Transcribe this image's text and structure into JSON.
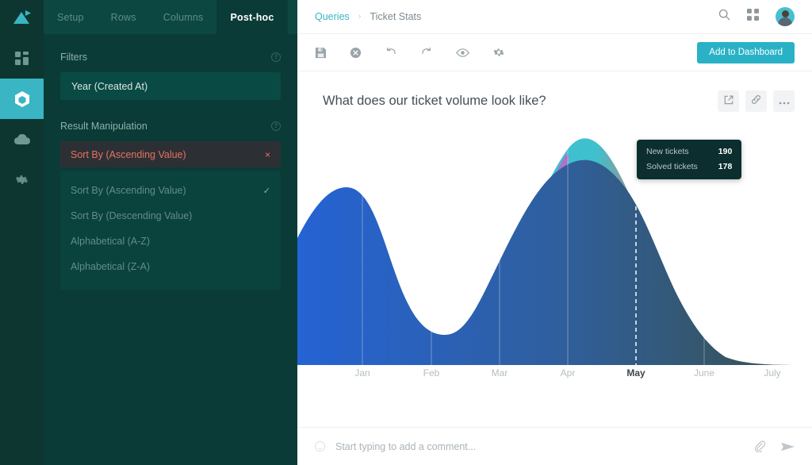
{
  "rail": {
    "logo_icon": "play-triangle-logo",
    "items": [
      {
        "icon": "dashboard-grid-icon",
        "name": "dashboard",
        "active": false
      },
      {
        "icon": "hexagon-query-icon",
        "name": "queries",
        "active": true
      },
      {
        "icon": "cloud-icon",
        "name": "cloud",
        "active": false
      },
      {
        "icon": "gear-icon",
        "name": "settings",
        "active": false
      }
    ]
  },
  "panel": {
    "tabs": [
      {
        "label": "Setup",
        "active": false
      },
      {
        "label": "Rows",
        "active": false
      },
      {
        "label": "Columns",
        "active": false
      },
      {
        "label": "Post-hoc",
        "active": true
      }
    ],
    "filters": {
      "heading": "Filters",
      "help": "?",
      "value": "Year (Created At)"
    },
    "result_manipulation": {
      "heading": "Result Manipulation",
      "help": "?",
      "selected": "Sort By (Ascending Value)",
      "remove_label": "×",
      "options": [
        {
          "label": "Sort By (Ascending Value)",
          "checked": true
        },
        {
          "label": "Sort By (Descending Value)",
          "checked": false
        },
        {
          "label": "Alphabetical (A-Z)",
          "checked": false
        },
        {
          "label": "Alphabetical (Z-A)",
          "checked": false
        }
      ],
      "check_glyph": "✓"
    }
  },
  "topbar": {
    "breadcrumb_root": "Queries",
    "breadcrumb_sep": "›",
    "breadcrumb_current": "Ticket Stats",
    "search_icon": "search-icon",
    "apps_icon": "apps-grid-icon",
    "avatar_icon": "user-avatar"
  },
  "toolbar": {
    "icons": [
      "save-icon",
      "cancel-icon",
      "undo-icon",
      "redo-icon",
      "preview-eye-icon",
      "settings-gear-icon"
    ],
    "primary_label": "Add to Dashboard"
  },
  "question": {
    "title": "What does our ticket volume look like?",
    "actions": [
      "open-external-icon",
      "link-icon",
      "more-options-icon"
    ]
  },
  "comment": {
    "placeholder": "Start typing to add a comment...",
    "value": "",
    "smiley_icon": "smiley-icon",
    "attach_icon": "paperclip-icon",
    "send_icon": "send-icon"
  },
  "colors": {
    "accent": "#3ab5c4",
    "panel_bg": "#0b3b37",
    "rail_bg": "#0d3631",
    "chip_red": "#e8705f",
    "series_new": "#2f6fd6",
    "series_solved": "#3fc0cf",
    "series_solved_end": "#ea6a5a",
    "overlap_purple": "#b070c8",
    "tooltip_bg": "#0c2e2e"
  },
  "chart_data": {
    "type": "area",
    "title": "What does our ticket volume look like?",
    "xlabel": "",
    "ylabel": "",
    "grid": true,
    "legend_position": "none",
    "categories": [
      "Jan",
      "Feb",
      "Mar",
      "Apr",
      "May",
      "June",
      "July"
    ],
    "active_category": "May",
    "tooltip": {
      "category": "May",
      "rows": [
        {
          "label": "New tickets",
          "value": 190
        },
        {
          "label": "Solved tickets",
          "value": 178
        }
      ]
    },
    "series": [
      {
        "name": "New tickets",
        "color": "#2f6fd6",
        "values": [
          110,
          150,
          120,
          62,
          40,
          95,
          190,
          175,
          120,
          60
        ]
      },
      {
        "name": "Solved tickets",
        "color": "#3fc0cf",
        "values": [
          130,
          175,
          130,
          40,
          12,
          60,
          178,
          200,
          175,
          120
        ]
      }
    ],
    "ylim": [
      0,
      215
    ],
    "x": [
      0,
      1,
      2,
      3,
      4,
      5,
      6,
      7,
      8,
      9
    ]
  }
}
